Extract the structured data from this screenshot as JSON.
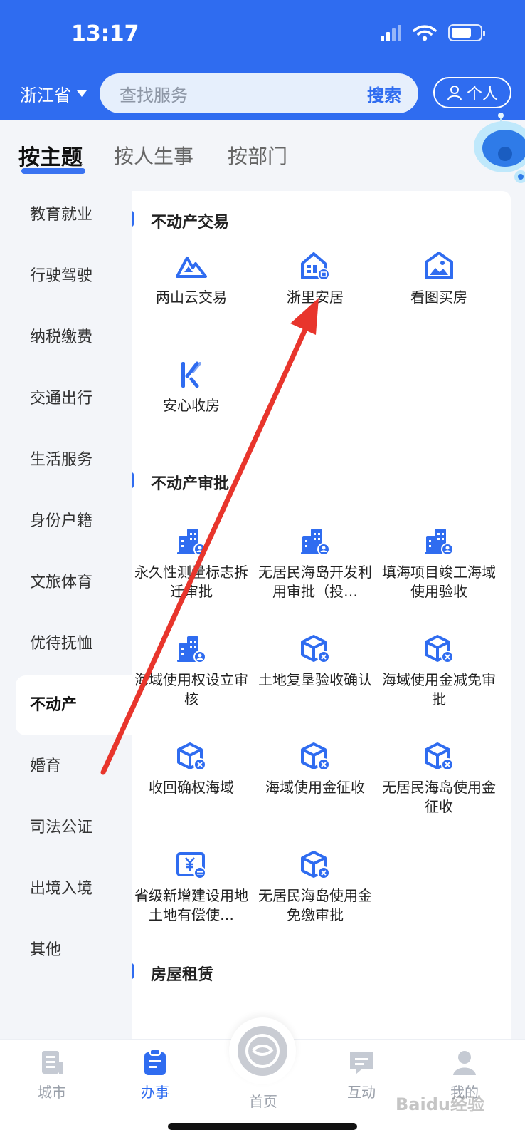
{
  "status_bar": {
    "time": "13:17"
  },
  "header": {
    "province": "浙江省",
    "search_placeholder": "查找服务",
    "search_button": "搜索",
    "personal_button": "个人"
  },
  "category_tabs": [
    {
      "label": "按主题",
      "active": true
    },
    {
      "label": "按人生事",
      "active": false
    },
    {
      "label": "按部门",
      "active": false
    }
  ],
  "sidebar": {
    "items": [
      {
        "label": "教育就业"
      },
      {
        "label": "行驶驾驶"
      },
      {
        "label": "纳税缴费"
      },
      {
        "label": "交通出行"
      },
      {
        "label": "生活服务"
      },
      {
        "label": "身份户籍"
      },
      {
        "label": "文旅体育"
      },
      {
        "label": "优待抚恤"
      },
      {
        "label": "不动产",
        "active": true
      },
      {
        "label": "婚育"
      },
      {
        "label": "司法公证"
      },
      {
        "label": "出境入境"
      },
      {
        "label": "其他"
      }
    ]
  },
  "sections": [
    {
      "title": "不动产交易",
      "services": [
        {
          "label": "两山云交易",
          "icon": "mountain-icon"
        },
        {
          "label": "浙里安居",
          "icon": "house-id-icon"
        },
        {
          "label": "看图买房",
          "icon": "house-picture-icon"
        },
        {
          "label": "安心收房",
          "icon": "key-lines-icon"
        }
      ]
    },
    {
      "title": "不动产审批",
      "services": [
        {
          "label": "永久性测量标志拆迁审批",
          "icon": "building-user-icon"
        },
        {
          "label": "无居民海岛开发利用审批（投…",
          "icon": "building-user-icon"
        },
        {
          "label": "填海项目竣工海域使用验收",
          "icon": "building-user-icon"
        },
        {
          "label": "海域使用权设立审核",
          "icon": "building-user-icon"
        },
        {
          "label": "土地复垦验收确认",
          "icon": "cube-x-icon"
        },
        {
          "label": "海域使用金减免审批",
          "icon": "cube-x-icon"
        },
        {
          "label": "收回确权海域",
          "icon": "cube-x-icon"
        },
        {
          "label": "海域使用金征收",
          "icon": "cube-x-icon"
        },
        {
          "label": "无居民海岛使用金征收",
          "icon": "cube-x-icon"
        },
        {
          "label": "省级新增建设用地土地有偿使…",
          "icon": "yuan-card-icon"
        },
        {
          "label": "无居民海岛使用金免缴审批",
          "icon": "cube-x-icon"
        }
      ]
    },
    {
      "title": "房屋租赁",
      "services": []
    }
  ],
  "bottom_nav": [
    {
      "label": "城市",
      "icon": "city-icon",
      "active": false
    },
    {
      "label": "办事",
      "icon": "clipboard-icon",
      "active": true
    },
    {
      "label": "首页",
      "icon": "home-logo-icon",
      "active": false
    },
    {
      "label": "互动",
      "icon": "chat-icon",
      "active": false
    },
    {
      "label": "我的",
      "icon": "user-icon",
      "active": false
    }
  ],
  "watermark": "Baidu经验",
  "colors": {
    "brand": "#2f6cf0",
    "annotation_arrow": "#e8352c"
  }
}
